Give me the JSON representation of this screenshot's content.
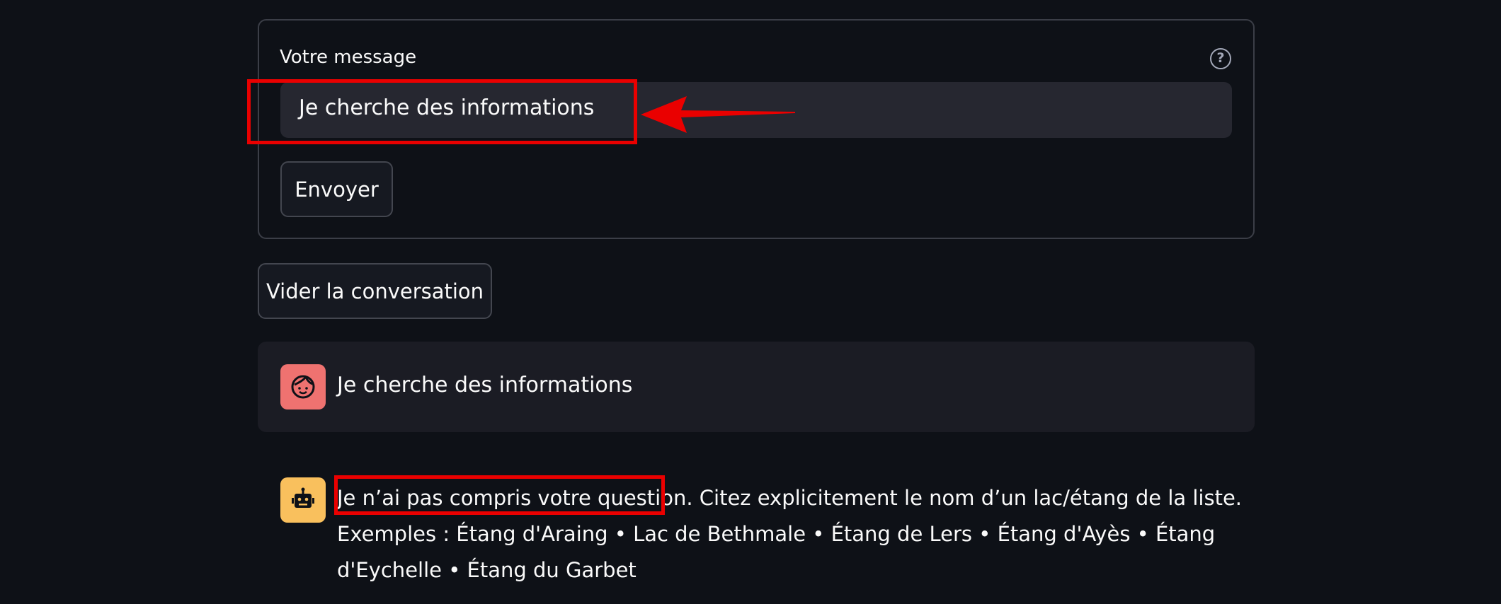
{
  "form": {
    "input_label": "Votre message",
    "input_value": "Je cherche des informations",
    "send_label": "Envoyer"
  },
  "clear_label": "Vider la conversation",
  "chat": {
    "user_message": "Je cherche des informations",
    "bot_message_highlight": "Je n’ai pas compris votre question.",
    "bot_message_rest": " Citez explicitement le nom d’un lac/étang de la liste. Exemples : Étang d'Araing • Lac de Bethmale • Étang de Lers • Étang d'Ayès • Étang d'Eychelle • Étang du Garbet"
  },
  "colors": {
    "background": "#0e1117",
    "user_avatar": "#ef7270",
    "bot_avatar": "#f9c05d",
    "annotation": "#ea0000"
  },
  "icons": {
    "help": "question-circle-icon",
    "user_avatar": "smiling-face-icon",
    "bot_avatar": "robot-icon",
    "annotation_arrow": "left-arrow-icon"
  }
}
